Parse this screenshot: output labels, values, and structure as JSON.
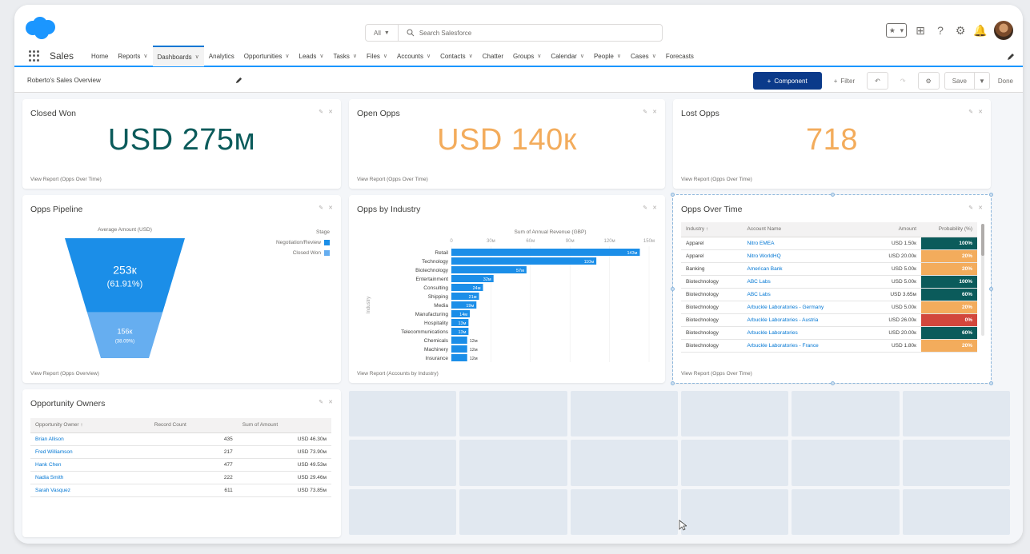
{
  "header": {
    "search_scope": "All",
    "search_placeholder": "Search Salesforce",
    "colors": {
      "brand": "#1b96ff",
      "primary_button": "#0b3a8a"
    }
  },
  "nav": {
    "app_name": "Sales",
    "items": [
      {
        "label": "Home",
        "caret": false
      },
      {
        "label": "Reports",
        "caret": true
      },
      {
        "label": "Dashboards",
        "caret": true,
        "active": true
      },
      {
        "label": "Analytics",
        "caret": false
      },
      {
        "label": "Opportunities",
        "caret": true
      },
      {
        "label": "Leads",
        "caret": true
      },
      {
        "label": "Tasks",
        "caret": true
      },
      {
        "label": "Files",
        "caret": true
      },
      {
        "label": "Accounts",
        "caret": true
      },
      {
        "label": "Contacts",
        "caret": true
      },
      {
        "label": "Chatter",
        "caret": false
      },
      {
        "label": "Groups",
        "caret": true
      },
      {
        "label": "Calendar",
        "caret": true
      },
      {
        "label": "People",
        "caret": true
      },
      {
        "label": "Cases",
        "caret": true
      },
      {
        "label": "Forecasts",
        "caret": false
      }
    ]
  },
  "toolbar": {
    "dashboard_title": "Roberto's Sales Overview",
    "component_label": "Component",
    "filter_label": "Filter",
    "save_label": "Save",
    "done_label": "Done"
  },
  "cards": {
    "closed_won": {
      "title": "Closed Won",
      "value": "USD 275м",
      "color": "#0b5b5b",
      "link": "View Report (Opps Over Time)"
    },
    "open_opps": {
      "title": "Open Opps",
      "value": "USD 140к",
      "color": "#f3ac5c",
      "link": "View Report (Opps Over Time)"
    },
    "lost_opps": {
      "title": "Lost Opps",
      "value": "718",
      "color": "#f3ac5c",
      "link": "View Report (Opps Over Time)"
    },
    "pipeline": {
      "title": "Opps Pipeline",
      "axis_label": "Average Amount (USD)",
      "legend_title": "Stage",
      "link": "View Report (Opps Overview)",
      "chart_data": {
        "type": "funnel",
        "xlabel": "Average Amount (USD)",
        "legend_title": "Stage",
        "series": [
          {
            "name": "Negotiation/Review",
            "value_label": "253к",
            "pct_label": "(61.91%)",
            "value": 253,
            "color": "#1b8ee8"
          },
          {
            "name": "Closed Won",
            "value_label": "156к",
            "pct_label": "(38.09%)",
            "value": 156,
            "color": "#66aef0"
          }
        ]
      }
    },
    "industry": {
      "title": "Opps by Industry",
      "link": "View Report (Accounts by Industry)",
      "chart_data": {
        "type": "bar",
        "orientation": "horizontal",
        "title": "Sum of Annual Revenue (GBP)",
        "ylabel": "Industry",
        "xlim": [
          0,
          150
        ],
        "x_ticks": [
          "0",
          "30м",
          "60м",
          "90м",
          "120м",
          "150м"
        ],
        "categories": [
          "Retail",
          "Technology",
          "Biotechnology",
          "Entertainment",
          "Consulting",
          "Shipping",
          "Media",
          "Manufacturing",
          "Hospitality",
          "Telecommunications",
          "Chemicals",
          "Machinery",
          "Insurance"
        ],
        "values": [
          143,
          110,
          57,
          32,
          24,
          21,
          19,
          14,
          13,
          13,
          12,
          12,
          12
        ],
        "value_labels": [
          "143м",
          "110м",
          "57м",
          "32м",
          "24м",
          "21м",
          "19м",
          "14м",
          "13м",
          "13м",
          "12м",
          "12м",
          "12м"
        ],
        "color": "#1b8ee8"
      }
    },
    "opps_over_time": {
      "title": "Opps Over Time",
      "link": "View Report (Opps Over Time)",
      "columns": [
        "Industry",
        "Account Name",
        "Amount",
        "Probability (%)"
      ],
      "rows": [
        {
          "industry": "Apparel",
          "account": "Nitro EMEA",
          "amount": "USD 1.50к",
          "prob": "100%",
          "color": "#0b5b5b"
        },
        {
          "industry": "Apparel",
          "account": "Nitro WorldHQ",
          "amount": "USD 20.00к",
          "prob": "20%",
          "color": "#f3ac5c"
        },
        {
          "industry": "Banking",
          "account": "American Bank",
          "amount": "USD 5.00к",
          "prob": "20%",
          "color": "#f3ac5c"
        },
        {
          "industry": "Biotechnology",
          "account": "ABC Labs",
          "amount": "USD 5.00к",
          "prob": "100%",
          "color": "#0b5b5b"
        },
        {
          "industry": "Biotechnology",
          "account": "ABC Labs",
          "amount": "USD 3.65м",
          "prob": "60%",
          "color": "#0b5b5b"
        },
        {
          "industry": "Biotechnology",
          "account": "Arbuckle Laboratories - Germany",
          "amount": "USD 5.00к",
          "prob": "20%",
          "color": "#f3ac5c"
        },
        {
          "industry": "Biotechnology",
          "account": "Arbuckle Laboratories - Austria",
          "amount": "USD 26.00к",
          "prob": "0%",
          "color": "#d2473c"
        },
        {
          "industry": "Biotechnology",
          "account": "Arbuckle Laboratories",
          "amount": "USD 20.00к",
          "prob": "60%",
          "color": "#0b5b5b"
        },
        {
          "industry": "Biotechnology",
          "account": "Arbuckle Laboratories - France",
          "amount": "USD 1.80к",
          "prob": "20%",
          "color": "#f3ac5c"
        }
      ]
    },
    "owners": {
      "title": "Opportunity Owners",
      "columns": [
        "Opportunity Owner",
        "Record Count",
        "Sum of Amount"
      ],
      "rows": [
        {
          "owner": "Brian Allison",
          "count": "435",
          "amount": "USD 46.30м"
        },
        {
          "owner": "Fred Williamson",
          "count": "217",
          "amount": "USD 73.90м"
        },
        {
          "owner": "Hank Chen",
          "count": "477",
          "amount": "USD 49.53м"
        },
        {
          "owner": "Nadia Smith",
          "count": "222",
          "amount": "USD 29.46м"
        },
        {
          "owner": "Sarah Vasquez",
          "count": "611",
          "amount": "USD 73.85м"
        }
      ]
    }
  }
}
